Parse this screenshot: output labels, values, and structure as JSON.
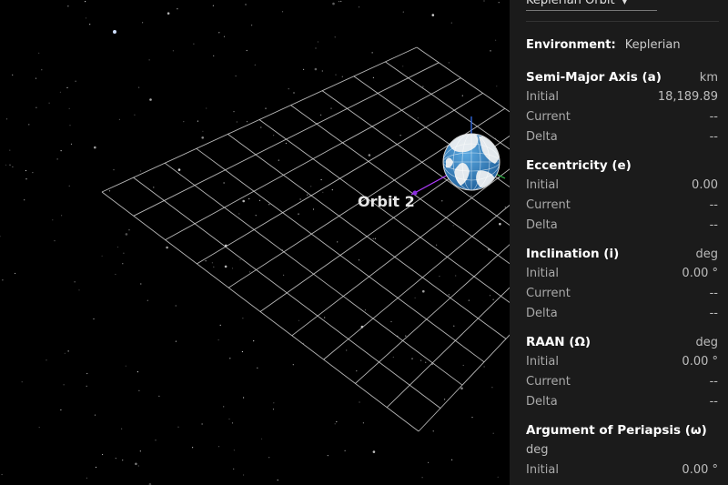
{
  "scene": {
    "orbit_label": "Orbit 2"
  },
  "panel": {
    "orbit_selector": {
      "label": "Keplerian Orbit",
      "icon": "chevron-down-icon"
    },
    "environment": {
      "label": "Environment:",
      "value": "Keplerian"
    },
    "parameters": [
      {
        "key": "semi-major-axis",
        "title": "Semi-Major Axis (a)",
        "unit": "km",
        "initial": "18,189.89",
        "current": "--",
        "delta": "--"
      },
      {
        "key": "eccentricity",
        "title": "Eccentricity (e)",
        "unit": "",
        "initial": "0.00",
        "current": "--",
        "delta": "--"
      },
      {
        "key": "inclination",
        "title": "Inclination (i)",
        "unit": "deg",
        "initial": "0.00 °",
        "current": "--",
        "delta": "--"
      },
      {
        "key": "raan",
        "title": "RAAN (Ω)",
        "unit": "deg",
        "initial": "0.00 °",
        "current": "--",
        "delta": "--"
      },
      {
        "key": "argument-of-periapsis",
        "title": "Argument of Periapsis (ω)",
        "unit": "deg",
        "unit_on_new_line": true,
        "initial": "0.00 °"
      }
    ],
    "row_labels": {
      "initial": "Initial",
      "current": "Current",
      "delta": "Delta"
    }
  }
}
